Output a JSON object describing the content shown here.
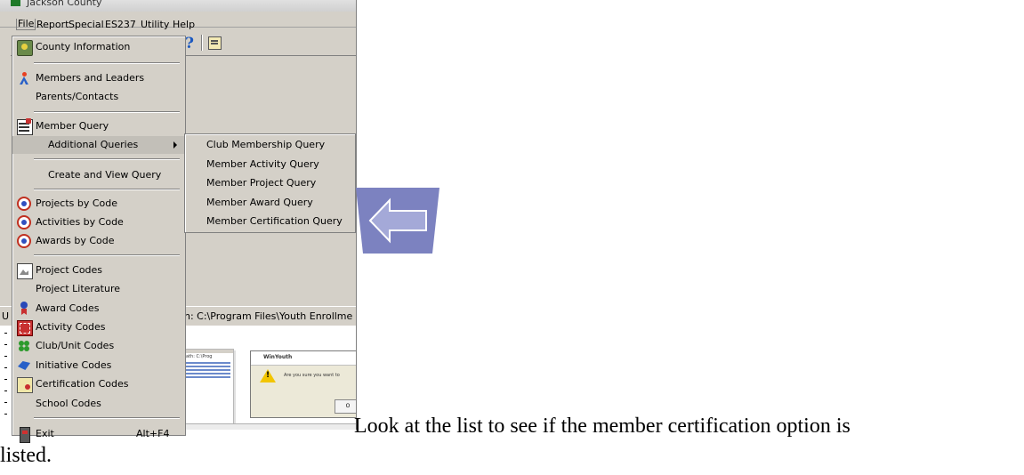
{
  "window": {
    "title": "Jackson County"
  },
  "menubar": {
    "items": [
      "File",
      "Report",
      "Special",
      "ES237",
      "Utility",
      "Help"
    ]
  },
  "file_menu": {
    "items": [
      {
        "label": "County Information",
        "icon": "county-icon"
      },
      {
        "label": "Members and Leaders",
        "icon": "members-icon"
      },
      {
        "label": "Parents/Contacts",
        "icon": ""
      },
      {
        "label": "Member Query",
        "icon": "query-icon"
      },
      {
        "label": "Additional Queries",
        "icon": "",
        "submenu": true
      },
      {
        "label": "Create and View Query",
        "icon": ""
      },
      {
        "label": "Projects by Code",
        "icon": "code-icon"
      },
      {
        "label": "Activities by Code",
        "icon": "code-icon"
      },
      {
        "label": "Awards by Code",
        "icon": "code-icon"
      },
      {
        "label": "Project Codes",
        "icon": "project-icon"
      },
      {
        "label": "Project Literature",
        "icon": ""
      },
      {
        "label": "Award Codes",
        "icon": "award-icon"
      },
      {
        "label": "Activity Codes",
        "icon": "activity-icon"
      },
      {
        "label": "Club/Unit Codes",
        "icon": "club-icon"
      },
      {
        "label": "Initiative Codes",
        "icon": "initiative-icon"
      },
      {
        "label": "Certification Codes",
        "icon": "certification-icon"
      },
      {
        "label": "School Codes",
        "icon": ""
      },
      {
        "label": "Exit",
        "shortcut": "Alt+F4",
        "icon": "exit-icon"
      }
    ]
  },
  "submenu": {
    "items": [
      "Club Membership Query",
      "Member Activity Query",
      "Member Project Query",
      "Member Award Query",
      "Member Certification Query"
    ]
  },
  "statusbar": {
    "left": "U",
    "path": "h:  C:\\Program Files\\Youth Enrollme"
  },
  "thumbnail": {
    "path_text": "ath: C:\\Prog"
  },
  "dialog": {
    "title": "WinYouth",
    "message": "Are you sure you want to",
    "ok_label": "O"
  },
  "colors": {
    "arrow_fill": "#7c82c0",
    "arrow_inner": "#a4a9d8",
    "window_bg": "#d4d0c8"
  },
  "caption": {
    "line1": "Look at the list to see if the member certification option is",
    "line2": "listed."
  }
}
